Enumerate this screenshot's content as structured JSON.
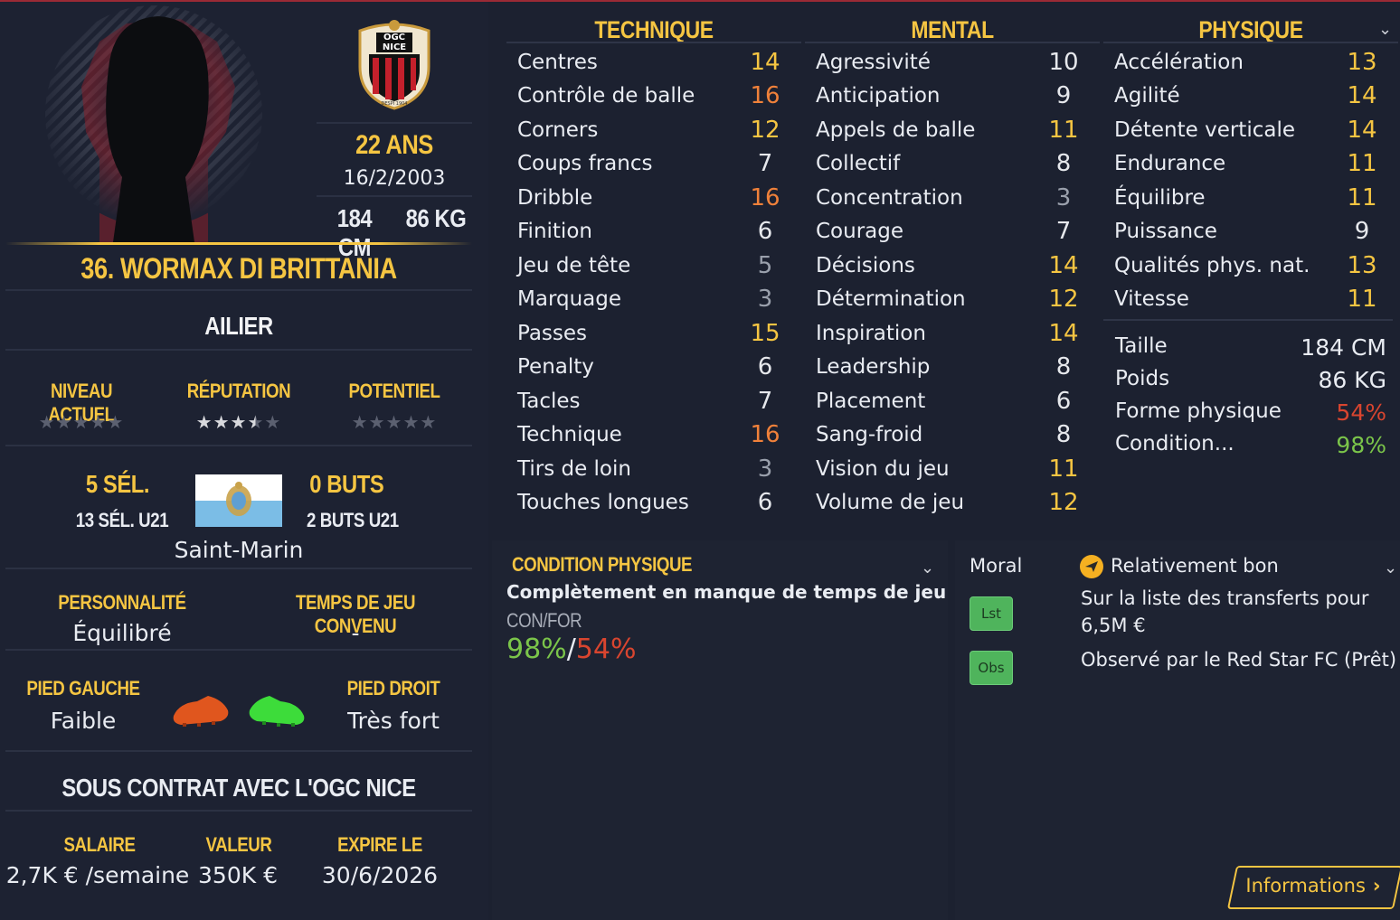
{
  "player": {
    "age": "22 ANS",
    "dob": "16/2/2003",
    "height": "184 CM",
    "weight": "86 KG",
    "name": "36. WORMAX DI BRITTANIA",
    "position": "AILIER",
    "club_badge_top": "OGC",
    "club_badge_bottom": "NICE",
    "club_badge_year": "DESPI 1904"
  },
  "ratings": {
    "current_label": "NIVEAU ACTUEL",
    "reputation_label": "RÉPUTATION",
    "potential_label": "POTENTIEL",
    "current_stars": 0,
    "reputation_stars": 3.5,
    "potential_stars": 0
  },
  "international": {
    "caps": "5 SÉL.",
    "caps_u21": "13 SÉL. U21",
    "goals": "0 BUTS",
    "goals_u21": "2 BUTS U21",
    "nation": "Saint-Marin"
  },
  "personality": {
    "label": "PERSONNALITÉ",
    "value": "Équilibré",
    "playtime_label": "TEMPS DE JEU CONVENU",
    "playtime_value": "-"
  },
  "feet": {
    "left_label": "PIED GAUCHE",
    "left_value": "Faible",
    "right_label": "PIED DROIT",
    "right_value": "Très fort",
    "left_color": "#e0561e",
    "right_color": "#3ddc3a"
  },
  "contract": {
    "title": "SOUS CONTRAT AVEC L'OGC NICE",
    "salary_label": "SALAIRE",
    "salary_value": "2,7K € /semaine",
    "value_label": "VALEUR",
    "value_value": "350K €",
    "expire_label": "EXPIRE LE",
    "expire_value": "30/6/2026"
  },
  "technique": {
    "title": "TECHNIQUE",
    "attrs": [
      {
        "name": "Centres",
        "value": "14",
        "tone": "gold"
      },
      {
        "name": "Contrôle de balle",
        "value": "16",
        "tone": "orange"
      },
      {
        "name": "Corners",
        "value": "12",
        "tone": "gold"
      },
      {
        "name": "Coups francs",
        "value": "7",
        "tone": "white"
      },
      {
        "name": "Dribble",
        "value": "16",
        "tone": "orange"
      },
      {
        "name": "Finition",
        "value": "6",
        "tone": "white"
      },
      {
        "name": "Jeu de tête",
        "value": "5",
        "tone": "grey"
      },
      {
        "name": "Marquage",
        "value": "3",
        "tone": "grey"
      },
      {
        "name": "Passes",
        "value": "15",
        "tone": "gold"
      },
      {
        "name": "Penalty",
        "value": "6",
        "tone": "white"
      },
      {
        "name": "Tacles",
        "value": "7",
        "tone": "white"
      },
      {
        "name": "Technique",
        "value": "16",
        "tone": "orange"
      },
      {
        "name": "Tirs de loin",
        "value": "3",
        "tone": "grey"
      },
      {
        "name": "Touches longues",
        "value": "6",
        "tone": "white"
      }
    ]
  },
  "mental": {
    "title": "MENTAL",
    "attrs": [
      {
        "name": "Agressivité",
        "value": "10",
        "tone": "white"
      },
      {
        "name": "Anticipation",
        "value": "9",
        "tone": "white"
      },
      {
        "name": "Appels de balle",
        "value": "11",
        "tone": "gold"
      },
      {
        "name": "Collectif",
        "value": "8",
        "tone": "white"
      },
      {
        "name": "Concentration",
        "value": "3",
        "tone": "grey"
      },
      {
        "name": "Courage",
        "value": "7",
        "tone": "white"
      },
      {
        "name": "Décisions",
        "value": "14",
        "tone": "gold"
      },
      {
        "name": "Détermination",
        "value": "12",
        "tone": "gold"
      },
      {
        "name": "Inspiration",
        "value": "14",
        "tone": "gold"
      },
      {
        "name": "Leadership",
        "value": "8",
        "tone": "white"
      },
      {
        "name": "Placement",
        "value": "6",
        "tone": "white"
      },
      {
        "name": "Sang-froid",
        "value": "8",
        "tone": "white"
      },
      {
        "name": "Vision du jeu",
        "value": "11",
        "tone": "gold"
      },
      {
        "name": "Volume de jeu",
        "value": "12",
        "tone": "gold"
      }
    ]
  },
  "physique": {
    "title": "PHYSIQUE",
    "attrs": [
      {
        "name": "Accélération",
        "value": "13",
        "tone": "gold"
      },
      {
        "name": "Agilité",
        "value": "14",
        "tone": "gold"
      },
      {
        "name": "Détente verticale",
        "value": "14",
        "tone": "gold"
      },
      {
        "name": "Endurance",
        "value": "11",
        "tone": "gold"
      },
      {
        "name": "Équilibre",
        "value": "11",
        "tone": "gold"
      },
      {
        "name": "Puissance",
        "value": "9",
        "tone": "white"
      },
      {
        "name": "Qualités phys. nat.",
        "value": "13",
        "tone": "gold"
      },
      {
        "name": "Vitesse",
        "value": "11",
        "tone": "gold"
      }
    ],
    "height_label": "Taille",
    "height_value": "184 CM",
    "weight_label": "Poids",
    "weight_value": "86 KG",
    "form_label": "Forme physique",
    "form_value": "54%",
    "condition_label": "Condition...",
    "condition_value": "98%"
  },
  "condition_panel": {
    "title": "CONDITION PHYSIQUE",
    "status": "Complètement en manque de temps de jeu",
    "con_for_label": "CON/FOR",
    "con_value": "98%",
    "slash": "/",
    "for_value": "54%"
  },
  "morale_panel": {
    "label": "Moral",
    "morale_text": "Relativement bon",
    "lst_label": "Lst",
    "obs_label": "Obs",
    "transfer_text_1": "Sur la liste des transferts pour",
    "transfer_text_2": "6,5M €",
    "scout_text": "Observé par le Red Star FC (Prêt)"
  },
  "info_button": "Informations",
  "colors": {
    "gold": "#f5c542",
    "orange": "#f0813a",
    "green": "#7bc54a",
    "red": "#d9452f",
    "bg": "#1c2130"
  }
}
